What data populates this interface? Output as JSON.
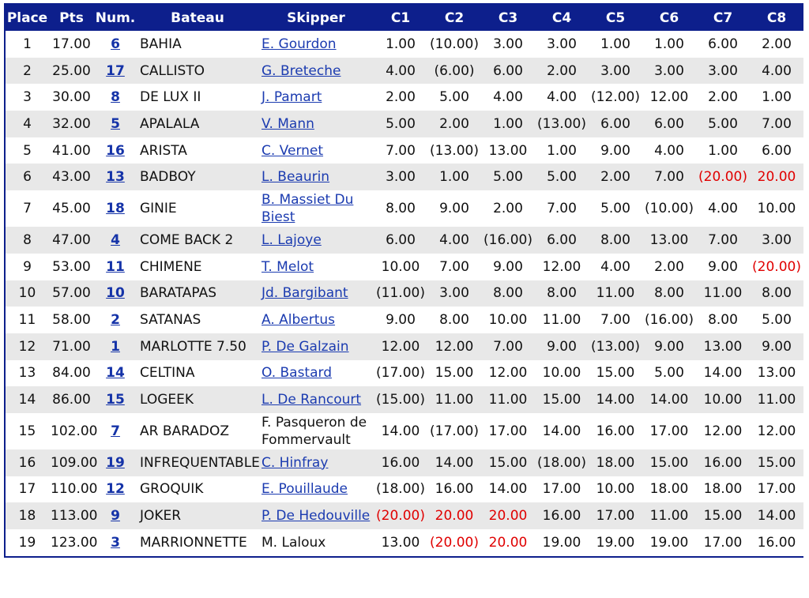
{
  "headers": [
    "Place",
    "Pts",
    "Num.",
    "Bateau",
    "Skipper",
    "C1",
    "C2",
    "C3",
    "C4",
    "C5",
    "C6",
    "C7",
    "C8"
  ],
  "colors": {
    "header_bg": "#0d1f8c",
    "header_text": "#ffffff",
    "alt_row": "#e8e8e8",
    "link": "#1b3bb0",
    "penalty_red": "#e00000"
  },
  "rows": [
    {
      "place": "1",
      "pts": "17.00",
      "num": "6",
      "boat": "BAHIA",
      "skipper": "E. Gourdon",
      "skipper_link": true,
      "races": [
        {
          "v": "1.00"
        },
        {
          "v": "(10.00)"
        },
        {
          "v": "3.00"
        },
        {
          "v": "3.00"
        },
        {
          "v": "1.00"
        },
        {
          "v": "1.00"
        },
        {
          "v": "6.00"
        },
        {
          "v": "2.00"
        }
      ]
    },
    {
      "place": "2",
      "pts": "25.00",
      "num": "17",
      "boat": "CALLISTO",
      "skipper": "G. Breteche",
      "skipper_link": true,
      "races": [
        {
          "v": "4.00"
        },
        {
          "v": "(6.00)"
        },
        {
          "v": "6.00"
        },
        {
          "v": "2.00"
        },
        {
          "v": "3.00"
        },
        {
          "v": "3.00"
        },
        {
          "v": "3.00"
        },
        {
          "v": "4.00"
        }
      ]
    },
    {
      "place": "3",
      "pts": "30.00",
      "num": "8",
      "boat": "DE LUX II",
      "skipper": "J. Pamart",
      "skipper_link": true,
      "races": [
        {
          "v": "2.00"
        },
        {
          "v": "5.00"
        },
        {
          "v": "4.00"
        },
        {
          "v": "4.00"
        },
        {
          "v": "(12.00)"
        },
        {
          "v": "12.00"
        },
        {
          "v": "2.00"
        },
        {
          "v": "1.00"
        }
      ]
    },
    {
      "place": "4",
      "pts": "32.00",
      "num": "5",
      "boat": "APALALA",
      "skipper": "V. Mann",
      "skipper_link": true,
      "races": [
        {
          "v": "5.00"
        },
        {
          "v": "2.00"
        },
        {
          "v": "1.00"
        },
        {
          "v": "(13.00)"
        },
        {
          "v": "6.00"
        },
        {
          "v": "6.00"
        },
        {
          "v": "5.00"
        },
        {
          "v": "7.00"
        }
      ]
    },
    {
      "place": "5",
      "pts": "41.00",
      "num": "16",
      "boat": "ARISTA",
      "skipper": "C. Vernet",
      "skipper_link": true,
      "races": [
        {
          "v": "7.00"
        },
        {
          "v": "(13.00)"
        },
        {
          "v": "13.00"
        },
        {
          "v": "1.00"
        },
        {
          "v": "9.00"
        },
        {
          "v": "4.00"
        },
        {
          "v": "1.00"
        },
        {
          "v": "6.00"
        }
      ]
    },
    {
      "place": "6",
      "pts": "43.00",
      "num": "13",
      "boat": "BADBOY",
      "skipper": "L. Beaurin",
      "skipper_link": true,
      "races": [
        {
          "v": "3.00"
        },
        {
          "v": "1.00"
        },
        {
          "v": "5.00"
        },
        {
          "v": "5.00"
        },
        {
          "v": "2.00"
        },
        {
          "v": "7.00"
        },
        {
          "v": "(20.00)",
          "red": true
        },
        {
          "v": "20.00",
          "red": true
        }
      ]
    },
    {
      "place": "7",
      "pts": "45.00",
      "num": "18",
      "boat": "GINIE",
      "skipper": "B. Massiet Du Biest",
      "skipper_link": true,
      "tall": true,
      "races": [
        {
          "v": "8.00"
        },
        {
          "v": "9.00"
        },
        {
          "v": "2.00"
        },
        {
          "v": "7.00"
        },
        {
          "v": "5.00"
        },
        {
          "v": "(10.00)"
        },
        {
          "v": "4.00"
        },
        {
          "v": "10.00"
        }
      ]
    },
    {
      "place": "8",
      "pts": "47.00",
      "num": "4",
      "boat": "COME BACK 2",
      "skipper": "L. Lajoye",
      "skipper_link": true,
      "races": [
        {
          "v": "6.00"
        },
        {
          "v": "4.00"
        },
        {
          "v": "(16.00)"
        },
        {
          "v": "6.00"
        },
        {
          "v": "8.00"
        },
        {
          "v": "13.00"
        },
        {
          "v": "7.00"
        },
        {
          "v": "3.00"
        }
      ]
    },
    {
      "place": "9",
      "pts": "53.00",
      "num": "11",
      "boat": "CHIMENE",
      "skipper": "T. Melot",
      "skipper_link": true,
      "races": [
        {
          "v": "10.00"
        },
        {
          "v": "7.00"
        },
        {
          "v": "9.00"
        },
        {
          "v": "12.00"
        },
        {
          "v": "4.00"
        },
        {
          "v": "2.00"
        },
        {
          "v": "9.00"
        },
        {
          "v": "(20.00)",
          "red": true
        }
      ]
    },
    {
      "place": "10",
      "pts": "57.00",
      "num": "10",
      "boat": "BARATAPAS",
      "skipper": "Jd. Bargibant",
      "skipper_link": true,
      "races": [
        {
          "v": "(11.00)"
        },
        {
          "v": "3.00"
        },
        {
          "v": "8.00"
        },
        {
          "v": "8.00"
        },
        {
          "v": "11.00"
        },
        {
          "v": "8.00"
        },
        {
          "v": "11.00"
        },
        {
          "v": "8.00"
        }
      ]
    },
    {
      "place": "11",
      "pts": "58.00",
      "num": "2",
      "boat": "SATANAS",
      "skipper": "A. Albertus",
      "skipper_link": true,
      "races": [
        {
          "v": "9.00"
        },
        {
          "v": "8.00"
        },
        {
          "v": "10.00"
        },
        {
          "v": "11.00"
        },
        {
          "v": "7.00"
        },
        {
          "v": "(16.00)"
        },
        {
          "v": "8.00"
        },
        {
          "v": "5.00"
        }
      ]
    },
    {
      "place": "12",
      "pts": "71.00",
      "num": "1",
      "boat": "MARLOTTE 7.50",
      "skipper": "P. De Galzain",
      "skipper_link": true,
      "races": [
        {
          "v": "12.00"
        },
        {
          "v": "12.00"
        },
        {
          "v": "7.00"
        },
        {
          "v": "9.00"
        },
        {
          "v": "(13.00)"
        },
        {
          "v": "9.00"
        },
        {
          "v": "13.00"
        },
        {
          "v": "9.00"
        }
      ]
    },
    {
      "place": "13",
      "pts": "84.00",
      "num": "14",
      "boat": "CELTINA",
      "skipper": "O. Bastard",
      "skipper_link": true,
      "races": [
        {
          "v": "(17.00)"
        },
        {
          "v": "15.00"
        },
        {
          "v": "12.00"
        },
        {
          "v": "10.00"
        },
        {
          "v": "15.00"
        },
        {
          "v": "5.00"
        },
        {
          "v": "14.00"
        },
        {
          "v": "13.00"
        }
      ]
    },
    {
      "place": "14",
      "pts": "86.00",
      "num": "15",
      "boat": "LOGEEK",
      "skipper": "L. De Rancourt",
      "skipper_link": true,
      "races": [
        {
          "v": "(15.00)"
        },
        {
          "v": "11.00"
        },
        {
          "v": "11.00"
        },
        {
          "v": "15.00"
        },
        {
          "v": "14.00"
        },
        {
          "v": "14.00"
        },
        {
          "v": "10.00"
        },
        {
          "v": "11.00"
        }
      ]
    },
    {
      "place": "15",
      "pts": "102.00",
      "num": "7",
      "boat": "AR BARADOZ",
      "skipper": "F. Pasqueron de Fommervault",
      "skipper_link": false,
      "tall": true,
      "races": [
        {
          "v": "14.00"
        },
        {
          "v": "(17.00)"
        },
        {
          "v": "17.00"
        },
        {
          "v": "14.00"
        },
        {
          "v": "16.00"
        },
        {
          "v": "17.00"
        },
        {
          "v": "12.00"
        },
        {
          "v": "12.00"
        }
      ]
    },
    {
      "place": "16",
      "pts": "109.00",
      "num": "19",
      "boat": "INFREQUENTABLE",
      "skipper": "C. Hinfray",
      "skipper_link": true,
      "races": [
        {
          "v": "16.00"
        },
        {
          "v": "14.00"
        },
        {
          "v": "15.00"
        },
        {
          "v": "(18.00)"
        },
        {
          "v": "18.00"
        },
        {
          "v": "15.00"
        },
        {
          "v": "16.00"
        },
        {
          "v": "15.00"
        }
      ]
    },
    {
      "place": "17",
      "pts": "110.00",
      "num": "12",
      "boat": "GROQUIK",
      "skipper": "E. Pouillaude",
      "skipper_link": true,
      "races": [
        {
          "v": "(18.00)"
        },
        {
          "v": "16.00"
        },
        {
          "v": "14.00"
        },
        {
          "v": "17.00"
        },
        {
          "v": "10.00"
        },
        {
          "v": "18.00"
        },
        {
          "v": "18.00"
        },
        {
          "v": "17.00"
        }
      ]
    },
    {
      "place": "18",
      "pts": "113.00",
      "num": "9",
      "boat": "JOKER",
      "skipper": "P. De Hedouville",
      "skipper_link": true,
      "races": [
        {
          "v": "(20.00)",
          "red": true
        },
        {
          "v": "20.00",
          "red": true
        },
        {
          "v": "20.00",
          "red": true
        },
        {
          "v": "16.00"
        },
        {
          "v": "17.00"
        },
        {
          "v": "11.00"
        },
        {
          "v": "15.00"
        },
        {
          "v": "14.00"
        }
      ]
    },
    {
      "place": "19",
      "pts": "123.00",
      "num": "3",
      "boat": "MARRIONNETTE",
      "skipper": "M. Laloux",
      "skipper_link": false,
      "races": [
        {
          "v": "13.00"
        },
        {
          "v": "(20.00)",
          "red": true
        },
        {
          "v": "20.00",
          "red": true
        },
        {
          "v": "19.00"
        },
        {
          "v": "19.00"
        },
        {
          "v": "19.00"
        },
        {
          "v": "17.00"
        },
        {
          "v": "16.00"
        }
      ]
    }
  ]
}
